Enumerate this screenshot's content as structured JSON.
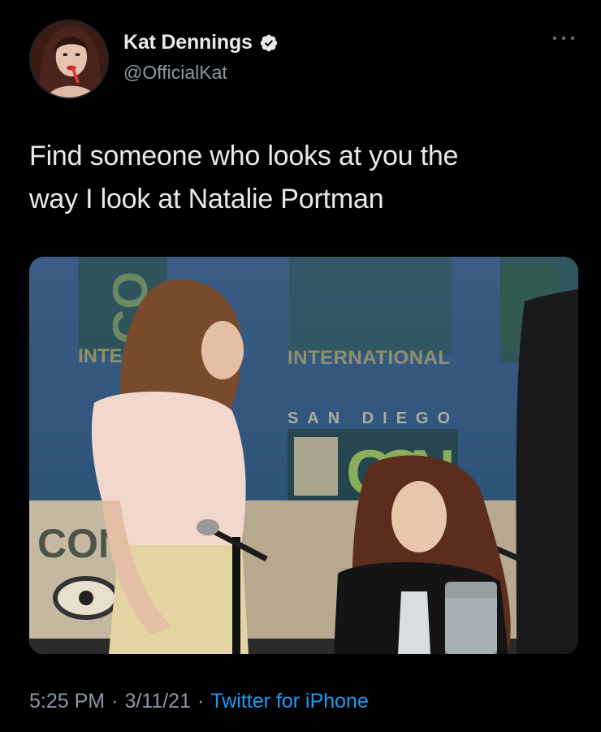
{
  "user": {
    "display_name": "Kat Dennings",
    "handle": "@OfficialKat",
    "verified": true,
    "avatar_icon": "profile-photo"
  },
  "tweet": {
    "text_line1": "Find someone who looks at you the",
    "text_line2": "way I look at Natalie Portman"
  },
  "media": {
    "type": "photo",
    "signage": {
      "comic_con": "CON",
      "international": "INTERNATIONAL",
      "san_diego": "SAN DIEGO",
      "inter_partial": "INTER",
      "con_partial": "CO"
    }
  },
  "meta": {
    "time": "5:25 PM",
    "separator": "·",
    "date": "3/11/21",
    "source": "Twitter for iPhone"
  },
  "colors": {
    "background": "#000000",
    "text_primary": "#e7e9ea",
    "text_secondary": "#8b98a5",
    "link": "#1d9bf0",
    "verified_badge": "#e7e9ea"
  }
}
